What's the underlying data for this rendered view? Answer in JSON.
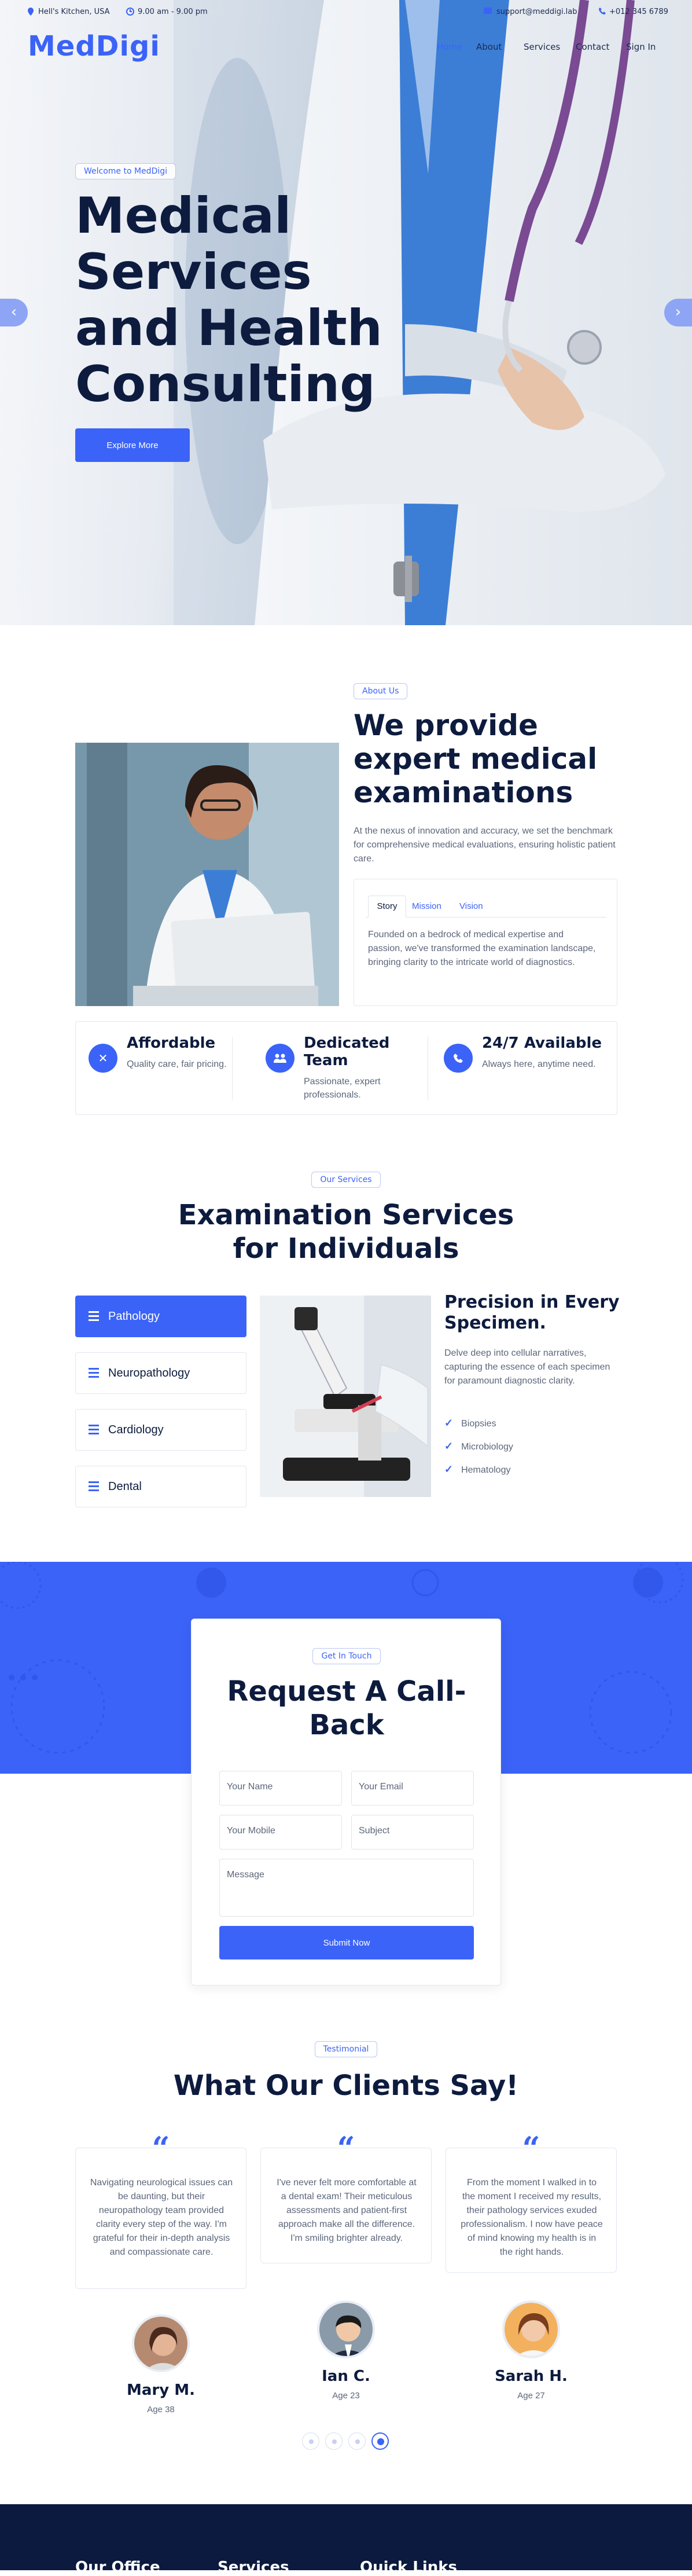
{
  "topbar": {
    "address": "Hell's Kitchen, USA",
    "hours": "9.00 am - 9.00 pm",
    "email": "support@meddigi.lab",
    "phone": "+012 345 6789"
  },
  "brand": {
    "name": "MedDigi",
    "accent": "#3b63f7",
    "dark": "#0d1b3e"
  },
  "nav": {
    "items": [
      "Home",
      "About",
      "Services",
      "Contact",
      "Sign In"
    ]
  },
  "hero": {
    "badge": "Welcome to MedDigi",
    "title": "Medical Services and Health Consulting",
    "cta": "Explore More",
    "prev_icon": "chevron-left",
    "next_icon": "chevron-right"
  },
  "about": {
    "badge": "About Us",
    "title": "We provide expert medical examinations",
    "intro": "At the nexus of innovation and accuracy, we set the benchmark for comprehensive medical evaluations, ensuring holistic patient care.",
    "tabs": [
      "Story",
      "Mission",
      "Vision"
    ],
    "active_tab": "Story",
    "tab_text": "Founded on a bedrock of medical expertise and passion, we've transformed the examination landscape, bringing clarity to the intricate world of diagnostics."
  },
  "features": [
    {
      "icon": "close-circle-icon",
      "title": "Affordable",
      "desc": "Quality care, fair pricing."
    },
    {
      "icon": "team-icon",
      "title": "Dedicated Team",
      "desc": "Passionate, expert professionals."
    },
    {
      "icon": "phone-icon",
      "title": "24/7 Available",
      "desc": "Always here, anytime need."
    }
  ],
  "services": {
    "badge": "Our Services",
    "title": "Examination Services for Individuals",
    "items": [
      "Pathology",
      "Neuropathology",
      "Cardiology",
      "Dental"
    ],
    "active": "Pathology",
    "detail_title": "Precision in Every Specimen.",
    "detail_text": "Delve deep into cellular narratives, capturing the essence of each specimen for paramount diagnostic clarity.",
    "checklist": [
      "Biopsies",
      "Microbiology",
      "Hematology"
    ]
  },
  "contact": {
    "badge": "Get In Touch",
    "title": "Request A Call-Back",
    "fields": {
      "name": "Your Name",
      "email": "Your Email",
      "mobile": "Your Mobile",
      "subject": "Subject",
      "message": "Message"
    },
    "submit": "Submit Now"
  },
  "testimonial": {
    "badge": "Testimonial",
    "title": "What Our Clients Say!",
    "items": [
      {
        "text": "Navigating neurological issues can be daunting, but their neuropathology team provided clarity every step of the way. I'm grateful for their in-depth analysis and compassionate care.",
        "name": "Mary M.",
        "age": "Age 38"
      },
      {
        "text": "I've never felt more comfortable at a dental exam! Their meticulous assessments and patient-first approach make all the difference. I'm smiling brighter already.",
        "name": "Ian C.",
        "age": "Age 23"
      },
      {
        "text": "From the moment I walked in to the moment I received my results, their pathology services exuded professionalism. I now have peace of mind knowing my health is in the right hands.",
        "name": "Sarah H.",
        "age": "Age 27"
      }
    ],
    "pager_count": 4,
    "pager_active": 4
  },
  "footer": {
    "columns": [
      "Our Office",
      "Services",
      "Quick Links"
    ]
  }
}
